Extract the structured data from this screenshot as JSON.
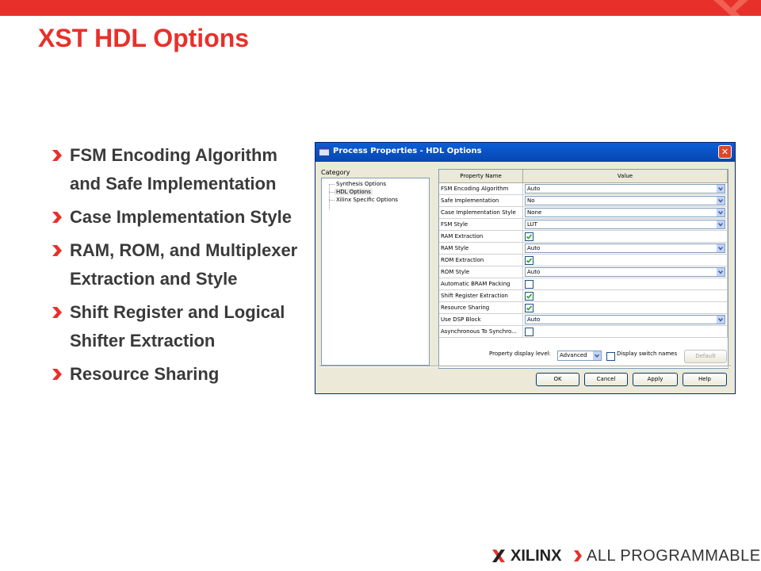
{
  "slide": {
    "title": "XST HDL Options",
    "bullets": [
      "FSM Encoding Algorithm and Safe Implementation",
      "Case Implementation Style",
      "RAM, ROM, and Multiplexer Extraction and Style",
      "Shift Register and Logical Shifter Extraction",
      "Resource Sharing"
    ],
    "accent_color": "#e8302a"
  },
  "dialog": {
    "title": "Process Properties - HDL Options",
    "category_label": "Category",
    "categories": [
      "Synthesis Options",
      "HDL Options",
      "Xilinx Specific Options"
    ],
    "selected_category": "HDL Options",
    "table_headers": [
      "Property Name",
      "Value"
    ],
    "rows": [
      {
        "name": "FSM Encoding Algorithm",
        "type": "combo",
        "value": "Auto"
      },
      {
        "name": "Safe Implementation",
        "type": "combo",
        "value": "No"
      },
      {
        "name": "Case Implementation Style",
        "type": "combo",
        "value": "None"
      },
      {
        "name": "FSM Style",
        "type": "combo",
        "value": "LUT"
      },
      {
        "name": "RAM Extraction",
        "type": "checkbox",
        "checked": true
      },
      {
        "name": "RAM Style",
        "type": "combo",
        "value": "Auto"
      },
      {
        "name": "ROM Extraction",
        "type": "checkbox",
        "checked": true
      },
      {
        "name": "ROM Style",
        "type": "combo",
        "value": "Auto"
      },
      {
        "name": "Automatic BRAM Packing",
        "type": "checkbox",
        "checked": false
      },
      {
        "name": "Shift Register Extraction",
        "type": "checkbox",
        "checked": true
      },
      {
        "name": "Resource Sharing",
        "type": "checkbox",
        "checked": true
      },
      {
        "name": "Use DSP Block",
        "type": "combo",
        "value": "Auto"
      },
      {
        "name": "Asynchronous To Synchro...",
        "type": "checkbox",
        "checked": false
      }
    ],
    "display_level_label": "Property display level:",
    "display_level_value": "Advanced",
    "display_switch_label": "Display switch names",
    "display_switch_checked": false,
    "default_button": "Default",
    "buttons": {
      "ok": "OK",
      "cancel": "Cancel",
      "apply": "Apply",
      "help": "Help"
    }
  },
  "footer": {
    "brand": "XILINX",
    "tagline": "ALL PROGRAMMABLE."
  }
}
